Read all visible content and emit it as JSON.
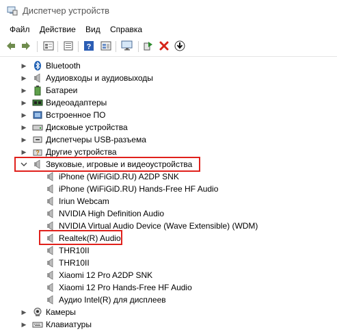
{
  "window": {
    "title": "Диспетчер устройств"
  },
  "menu": [
    "Файл",
    "Действие",
    "Вид",
    "Справка"
  ],
  "toolbar": {
    "icons": [
      "back-icon",
      "forward-icon",
      "properties-icon",
      "list-icon",
      "help-icon",
      "update-icon",
      "monitor-icon",
      "enable-icon",
      "remove-icon",
      "download-icon"
    ]
  },
  "tree": {
    "categories_top": [
      {
        "label": "Bluetooth",
        "icon": "bluetooth-icon"
      },
      {
        "label": "Аудиовходы и аудиовыходы",
        "icon": "audio-io-icon"
      },
      {
        "label": "Батареи",
        "icon": "battery-icon"
      },
      {
        "label": "Видеоадаптеры",
        "icon": "display-adapter-icon"
      },
      {
        "label": "Встроенное ПО",
        "icon": "firmware-icon"
      },
      {
        "label": "Дисковые устройства",
        "icon": "disk-icon"
      },
      {
        "label": "Диспетчеры USB-разъема",
        "icon": "usb-icon"
      },
      {
        "label": "Другие устройства",
        "icon": "other-device-icon"
      }
    ],
    "expanded_category": {
      "label": "Звуковые, игровые и видеоустройства",
      "icon": "sound-icon"
    },
    "devices": [
      "iPhone (WiFiGiD.RU) A2DP SNK",
      "iPhone (WiFiGiD.RU) Hands-Free HF Audio",
      "Iriun Webcam",
      "NVIDIA High Definition Audio",
      "NVIDIA Virtual Audio Device (Wave Extensible) (WDM)",
      "Realtek(R) Audio",
      "THR10II",
      "THR10II",
      "Xiaomi 12 Pro A2DP SNK",
      "Xiaomi 12 Pro Hands-Free HF Audio",
      "Аудио Intel(R) для дисплеев"
    ],
    "categories_bottom": [
      {
        "label": "Камеры",
        "icon": "camera-icon"
      },
      {
        "label": "Клавиатуры",
        "icon": "keyboard-icon"
      }
    ]
  },
  "colors": {
    "highlight": "#e0201b"
  }
}
